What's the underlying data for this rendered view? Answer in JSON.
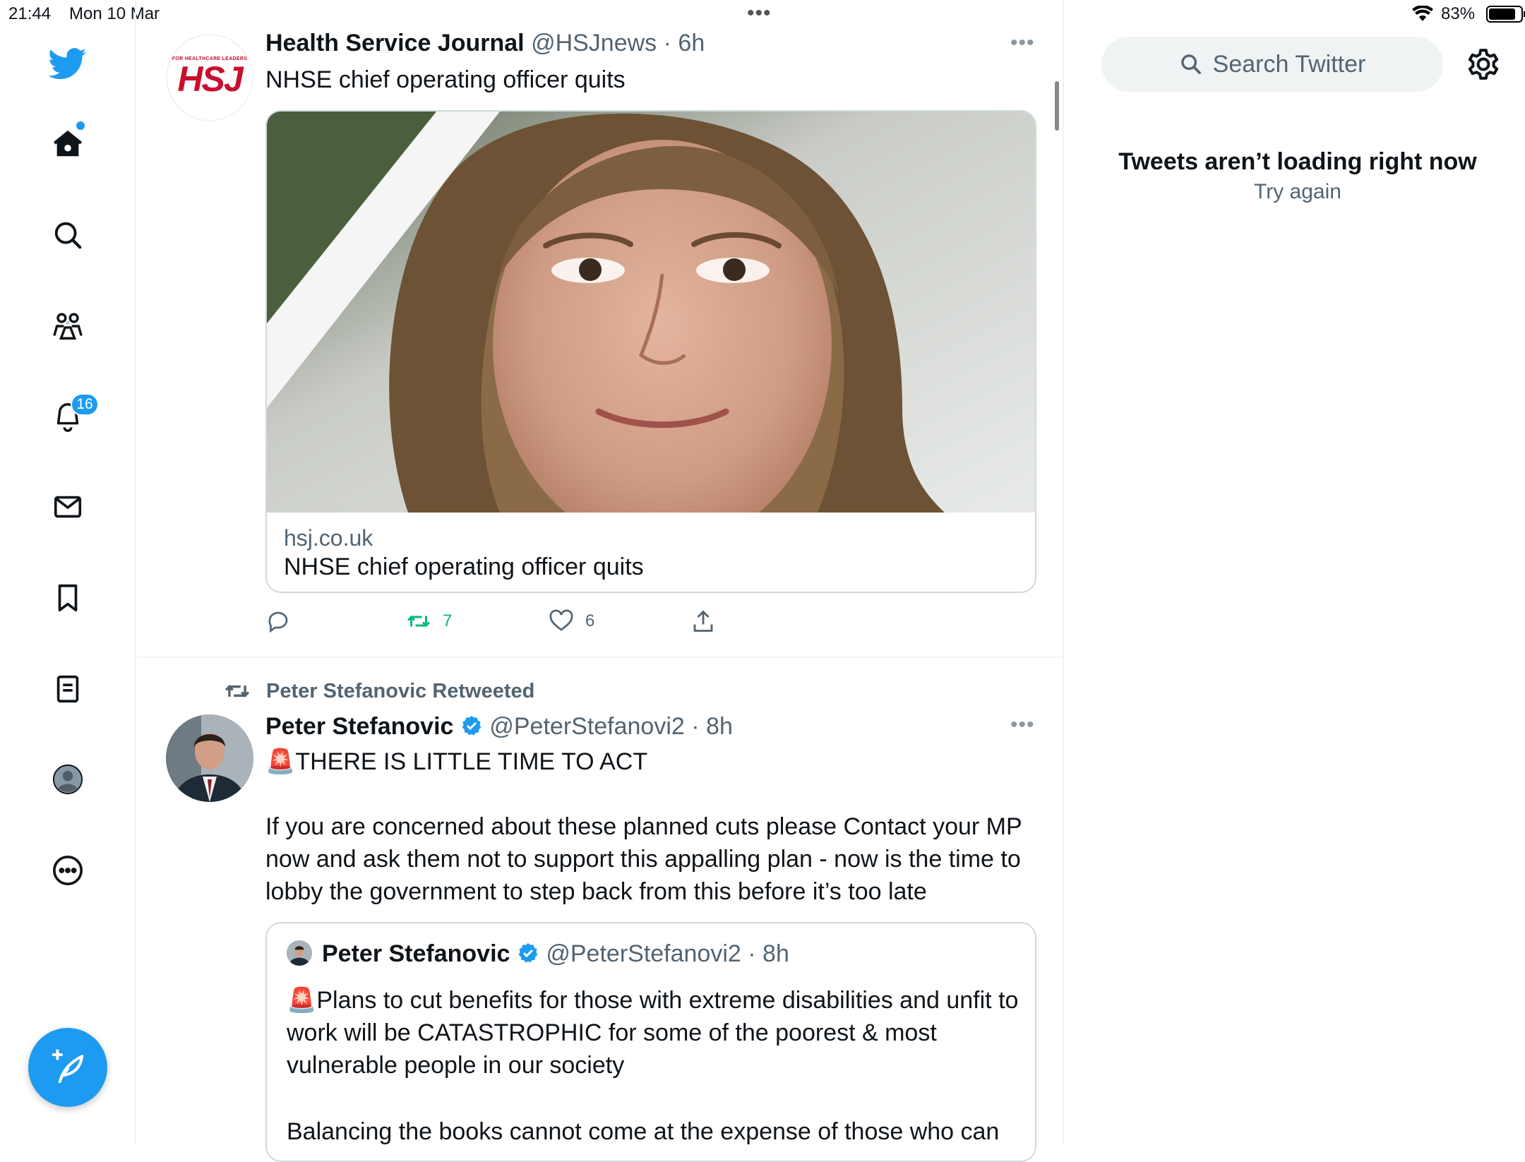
{
  "status_bar": {
    "time": "21:44",
    "date": "Mon 10 Mar",
    "multitask_dots": "•••",
    "battery_percent": "83%",
    "battery_level": 0.83
  },
  "nav": {
    "items": [
      "Twitter",
      "Home",
      "Explore",
      "Communities",
      "Notifications",
      "Messages",
      "Bookmarks",
      "Lists",
      "Profile",
      "More"
    ],
    "notifications_badge": "16",
    "compose_label": "Tweet"
  },
  "tweets": [
    {
      "author": "Health Service Journal",
      "handle": "@HSJnews",
      "time": "· 6h",
      "avatar_text_small": "FOR HEALTHCARE LEADERS",
      "avatar_text_big": "HSJ",
      "text": "NHSE chief operating officer quits",
      "card": {
        "domain": "hsj.co.uk",
        "title": "NHSE chief operating officer quits"
      },
      "actions": {
        "replies": "",
        "retweets": "7",
        "likes": "6"
      }
    },
    {
      "retweeted_by": "Peter Stefanovic Retweeted",
      "author": "Peter Stefanovic",
      "handle": "@PeterStefanovi2",
      "time": "· 8h",
      "text_line1": "🚨THERE IS LITTLE TIME TO ACT",
      "text_para2": "If you are concerned about these planned cuts please Contact your MP now and ask them not to support this appalling plan  - now is the time to lobby the government to step back from this before it’s too late",
      "quote": {
        "author": "Peter Stefanovic",
        "handle": "@PeterStefanovi2",
        "time": "· 8h",
        "text_para1": "🚨Plans to cut benefits for those with extreme disabilities and unfit to work will be CATASTROPHIC for some of the poorest & most vulnerable people in our society",
        "text_para2": "Balancing the books cannot come at the expense of those who can"
      }
    }
  ],
  "sidebar": {
    "search_placeholder": "Search Twitter",
    "error_title": "Tweets aren’t loading right now",
    "error_retry": "Try again"
  },
  "colors": {
    "accent": "#1d9bf0",
    "retweet_green": "#00ba7c",
    "muted": "#536471",
    "border": "#cfd9de"
  }
}
